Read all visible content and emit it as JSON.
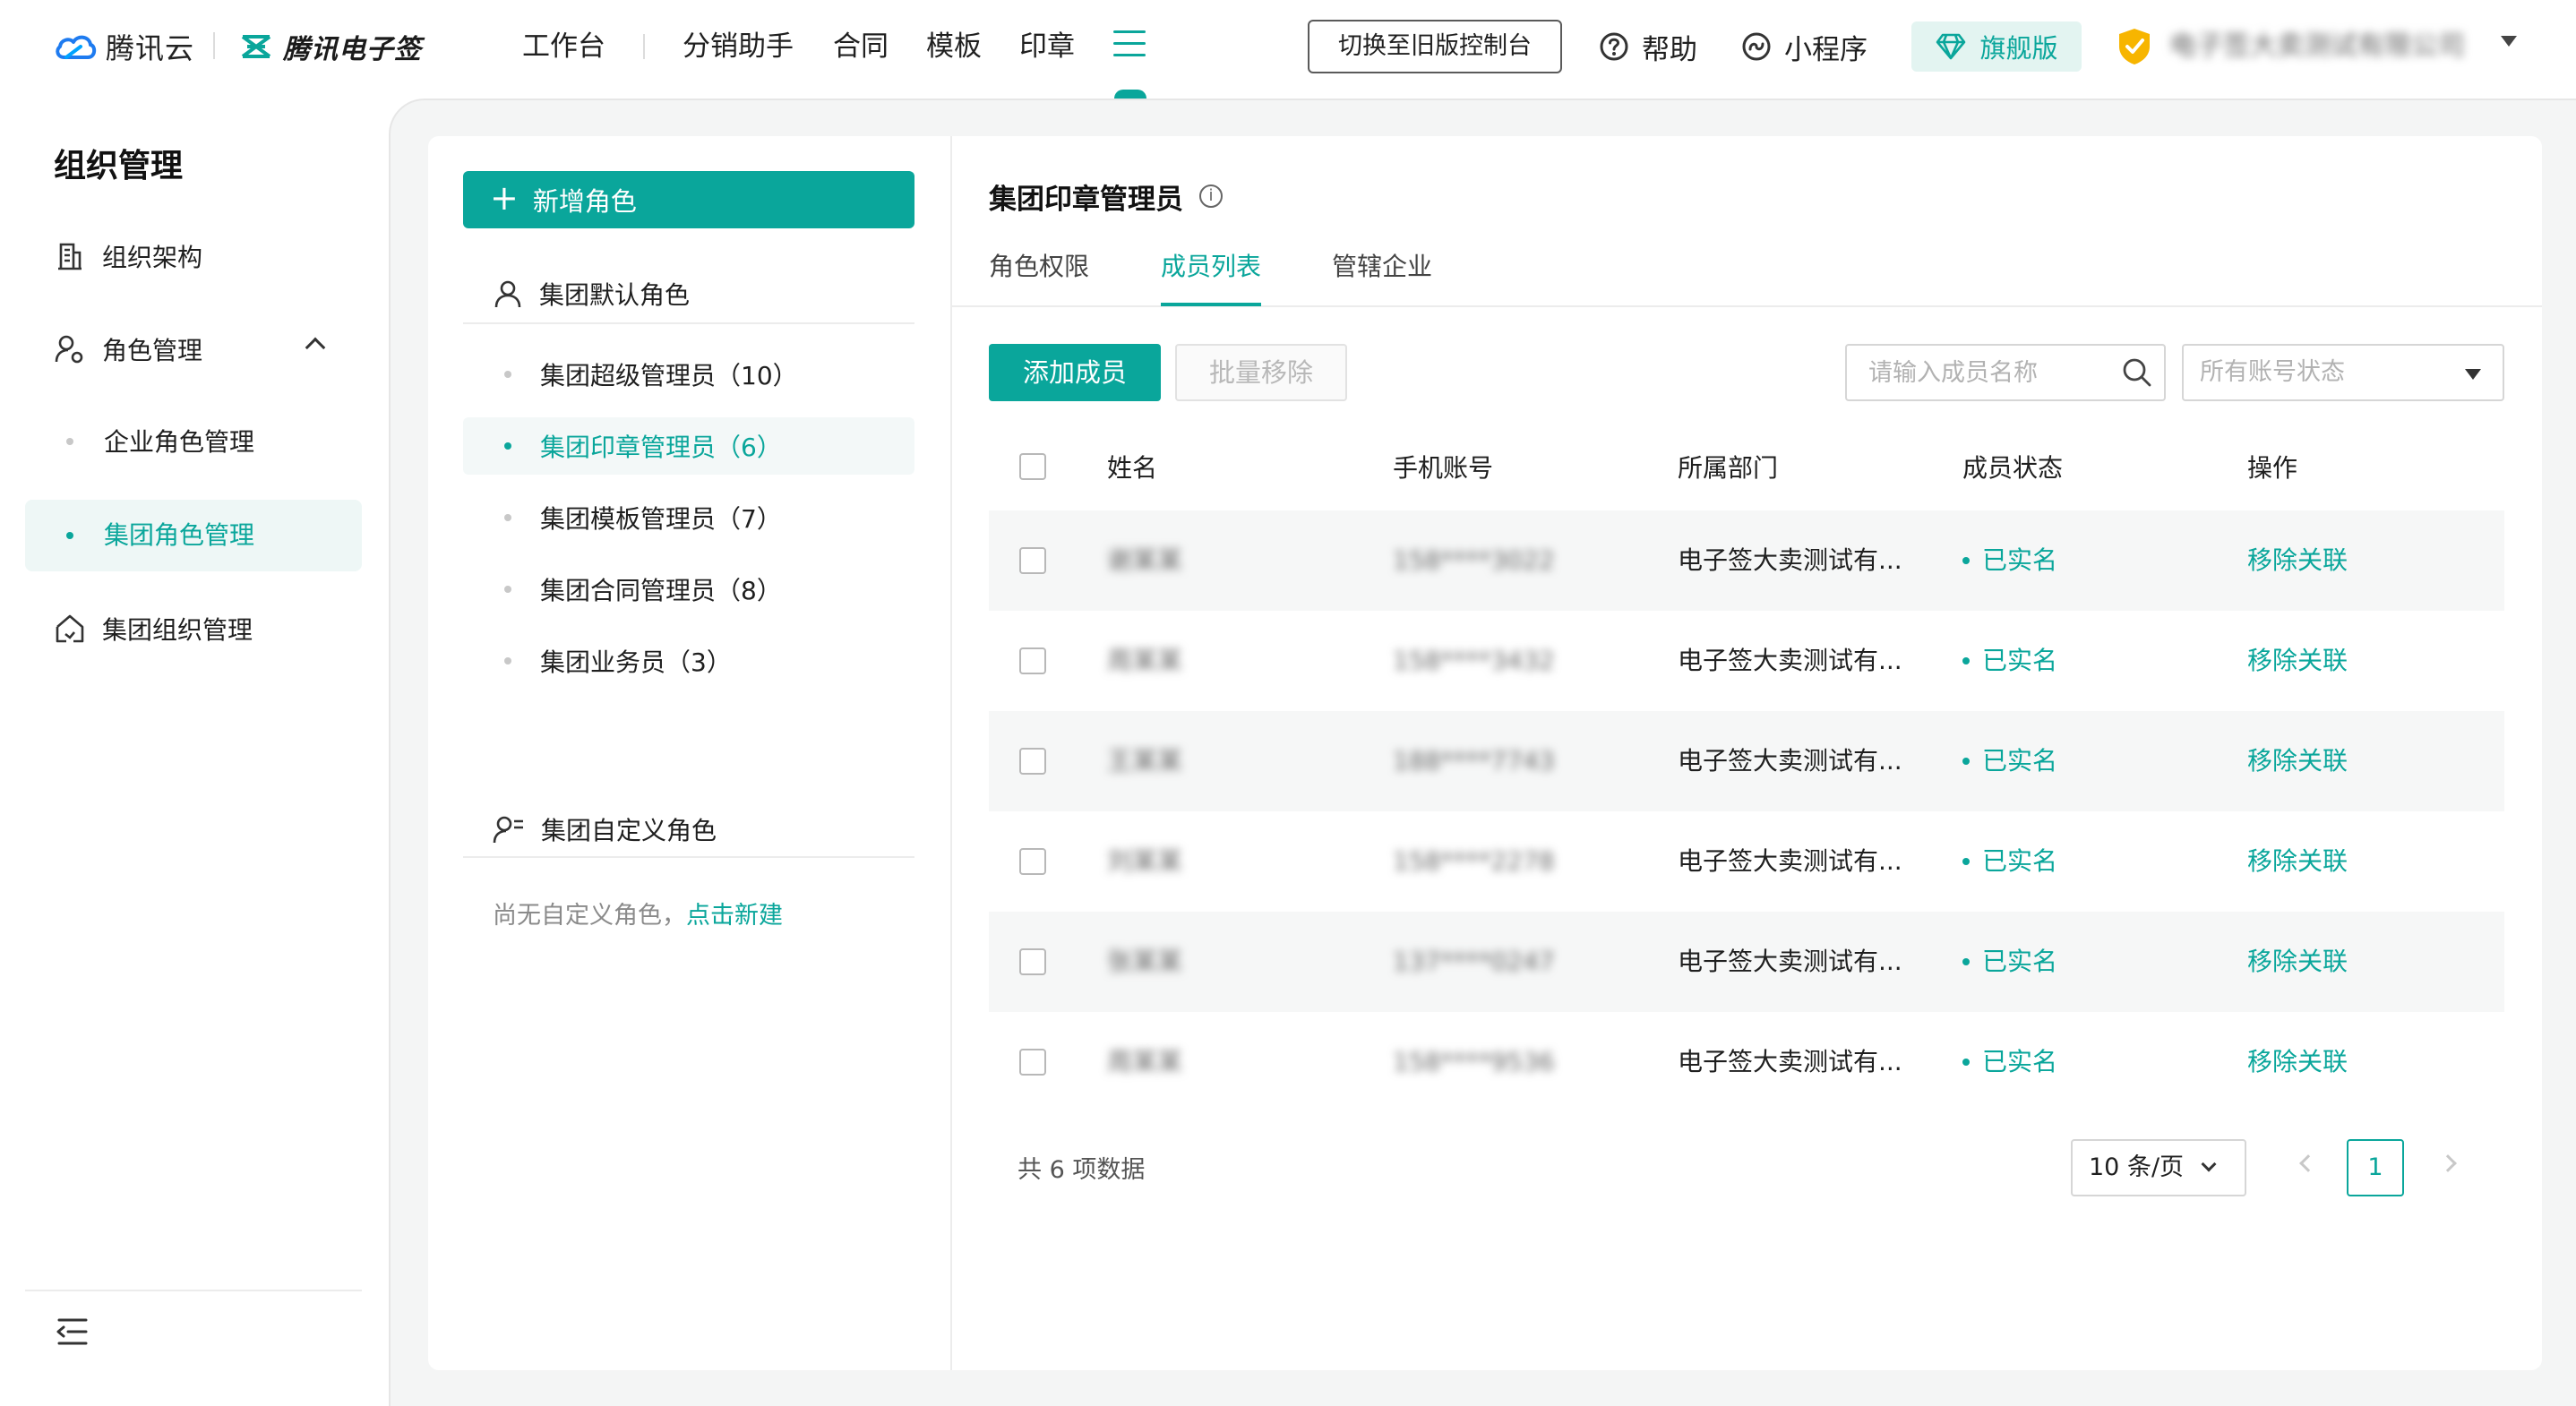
{
  "brand": {
    "cloud_name": "腾讯云",
    "esign_name": "腾讯电子签",
    "accent": "#0aa69b"
  },
  "topnav": {
    "items": [
      "工作台",
      "分销助手",
      "合同",
      "模板",
      "印章"
    ],
    "switch_label": "切换至旧版控制台",
    "help_label": "帮助",
    "mini_label": "小程序",
    "edition_label": "旗舰版",
    "company_name": "电子签大卖测试有限公司"
  },
  "sidebar": {
    "title": "组织管理",
    "items": [
      {
        "label": "组织架构",
        "icon": "org-building-icon"
      },
      {
        "label": "角色管理",
        "icon": "user-role-icon"
      },
      {
        "label": "集团组织管理",
        "icon": "group-org-icon"
      }
    ],
    "sub_items": [
      "企业角色管理",
      "集团角色管理"
    ],
    "active_sub": "集团角色管理"
  },
  "roles": {
    "add_label": "新增角色",
    "default_group_label": "集团默认角色",
    "default_roles": [
      {
        "label": "集团超级管理员（10）"
      },
      {
        "label": "集团印章管理员（6）"
      },
      {
        "label": "集团模板管理员（7）"
      },
      {
        "label": "集团合同管理员（8）"
      },
      {
        "label": "集团业务员（3）"
      }
    ],
    "active_index": 1,
    "custom_group_label": "集团自定义角色",
    "custom_empty_text": "尚无自定义角色，",
    "custom_create_link": "点击新建"
  },
  "detail": {
    "title": "集团印章管理员",
    "tabs": [
      "角色权限",
      "成员列表",
      "管辖企业"
    ],
    "active_tab": "成员列表",
    "add_member_label": "添加成员",
    "batch_remove_label": "批量移除",
    "search_placeholder": "请输入成员名称",
    "status_select_placeholder": "所有账号状态"
  },
  "table": {
    "columns": [
      "姓名",
      "手机账号",
      "所属部门",
      "成员状态",
      "操作"
    ],
    "rows": [
      {
        "name": "谢某某",
        "phone": "158****3022",
        "dept": "电子签大卖测试有...",
        "status": "已实名",
        "action": "移除关联"
      },
      {
        "name": "周某某",
        "phone": "158****3432",
        "dept": "电子签大卖测试有...",
        "status": "已实名",
        "action": "移除关联"
      },
      {
        "name": "王某某",
        "phone": "188****7743",
        "dept": "电子签大卖测试有...",
        "status": "已实名",
        "action": "移除关联"
      },
      {
        "name": "刘某某",
        "phone": "158****2278",
        "dept": "电子签大卖测试有...",
        "status": "已实名",
        "action": "移除关联"
      },
      {
        "name": "张某某",
        "phone": "137****0247",
        "dept": "电子签大卖测试有...",
        "status": "已实名",
        "action": "移除关联"
      },
      {
        "name": "周某某",
        "phone": "158****9536",
        "dept": "电子签大卖测试有...",
        "status": "已实名",
        "action": "移除关联"
      }
    ]
  },
  "pagination": {
    "total_text": "共 6 项数据",
    "page_size_label": "10 条/页",
    "current_page": "1"
  }
}
